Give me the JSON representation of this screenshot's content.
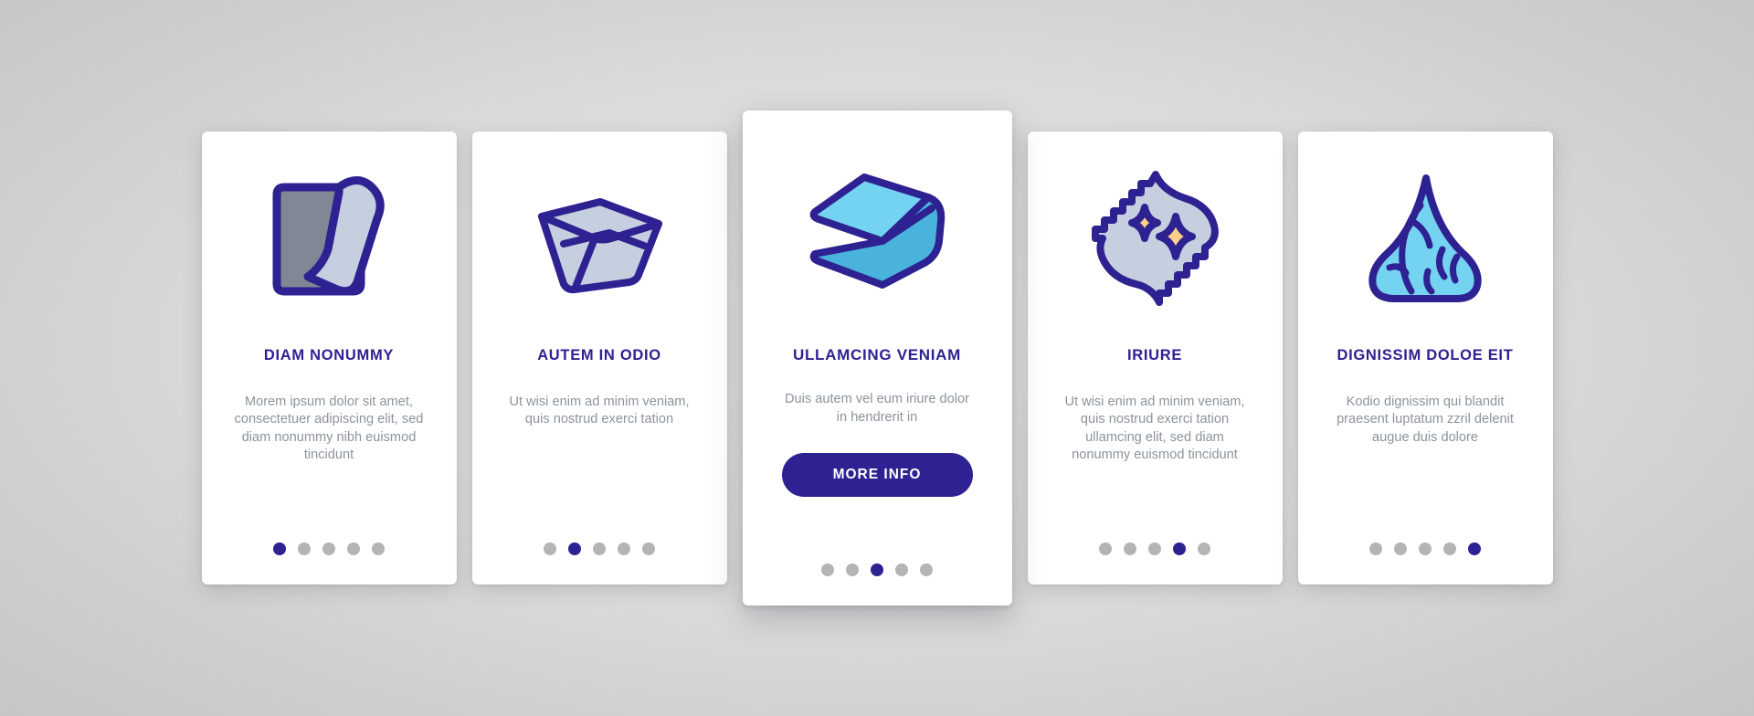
{
  "theme": {
    "brand_primary": "#2e2191",
    "icon_gray_fill": "#7f8894",
    "icon_light_fill": "#c6cfdf",
    "icon_cyan_fill": "#73d3f0",
    "icon_blue_fill": "#4ab3dd",
    "sparkle_fill": "#ffd08a",
    "body_text": "#8b939c",
    "dot_inactive": "#b4b4b4",
    "card_bg": "#ffffff",
    "page_bg": "#d9d9d9"
  },
  "cards": [
    {
      "icon_name": "folded-cloth-icon",
      "title": "DIAM NONUMMY",
      "description": "Morem ipsum dolor sit amet, consectetuer adipiscing elit, sed diam nonummy nibh euismod tincidunt",
      "dots": [
        true,
        false,
        false,
        false,
        false
      ],
      "featured": false
    },
    {
      "icon_name": "basin-tray-icon",
      "title": "AUTEM IN ODIO",
      "description": "Ut wisi enim ad minim veniam, quis nostrud exerci tation",
      "dots": [
        false,
        true,
        false,
        false,
        false
      ],
      "featured": false
    },
    {
      "icon_name": "folded-towels-icon",
      "title": "ULLAMCING VENIAM",
      "description": "Duis autem vel eum iriure dolor in hendrerit in",
      "cta_label": "MORE INFO",
      "dots": [
        false,
        false,
        true,
        false,
        false
      ],
      "featured": true
    },
    {
      "icon_name": "sparkling-cloth-icon",
      "title": "IRIURE",
      "description": "Ut wisi enim ad minim veniam, quis nostrud exerci tation ullamcing elit, sed diam nonummy euismod tincidunt",
      "dots": [
        false,
        false,
        false,
        true,
        false
      ],
      "featured": false
    },
    {
      "icon_name": "water-drop-icon",
      "title": "DIGNISSIM DOLOE EIT",
      "description": "Kodio dignissim qui blandit praesent luptatum zzril delenit augue duis dolore",
      "dots": [
        false,
        false,
        false,
        false,
        true
      ],
      "featured": false
    }
  ]
}
